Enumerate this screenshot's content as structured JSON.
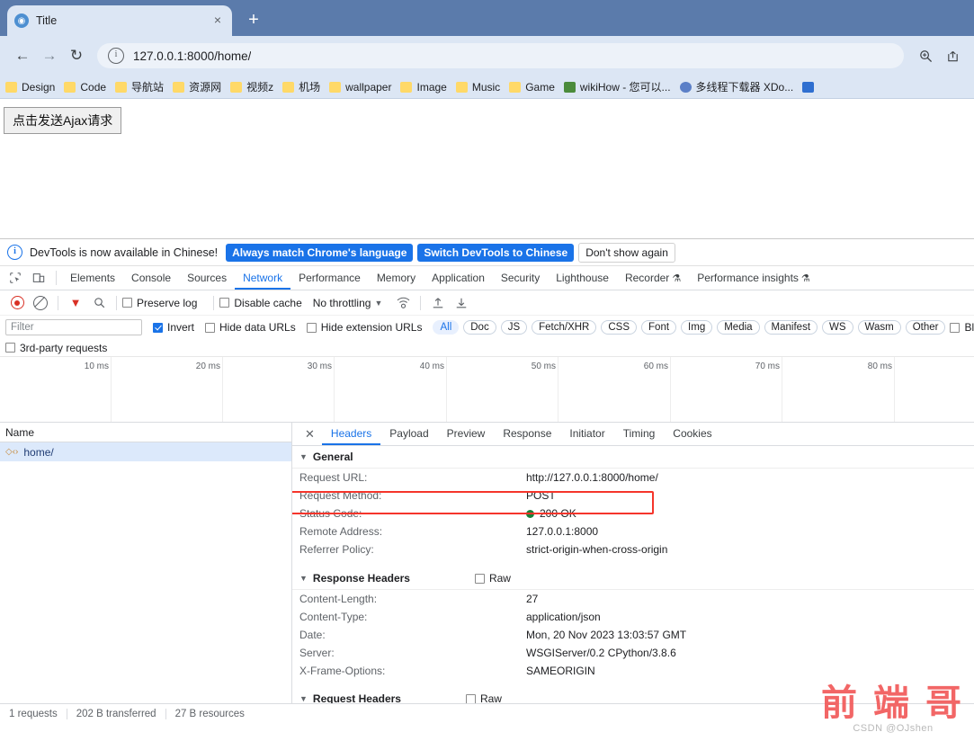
{
  "browser": {
    "tab": {
      "title": "Title",
      "favicon": "globe-icon",
      "close": "×"
    },
    "new_tab": "+",
    "nav": {
      "back": "←",
      "forward": "→",
      "reload": "↻"
    },
    "omnibox": {
      "info_icon": "ⓘ",
      "url": "127.0.0.1:8000/home/"
    },
    "toolbar_icons": {
      "zoom": "⊕",
      "share": "⤴"
    },
    "bookmarks": [
      {
        "label": "Design",
        "icon": "folder-icon"
      },
      {
        "label": "Code",
        "icon": "folder-icon"
      },
      {
        "label": "导航站",
        "icon": "folder-icon"
      },
      {
        "label": "资源网",
        "icon": "folder-icon"
      },
      {
        "label": "视频z",
        "icon": "folder-icon"
      },
      {
        "label": "机场",
        "icon": "folder-icon"
      },
      {
        "label": "wallpaper",
        "icon": "folder-icon"
      },
      {
        "label": "Image",
        "icon": "folder-icon"
      },
      {
        "label": "Music",
        "icon": "folder-icon"
      },
      {
        "label": "Game",
        "icon": "folder-icon"
      },
      {
        "label": "wikiHow - 您可以...",
        "icon": "wikihow-favicon"
      },
      {
        "label": "多线程下载器 XDo...",
        "icon": "xdown-favicon"
      },
      {
        "label": "",
        "icon": "site-favicon"
      }
    ]
  },
  "page": {
    "ajax_button": "点击发送Ajax请求"
  },
  "devtools": {
    "banner": {
      "icon": "info-icon",
      "message": "DevTools is now available in Chinese!",
      "primary_button": "Always match Chrome's language",
      "secondary_button": "Switch DevTools to Chinese",
      "dismiss_button": "Don't show again"
    },
    "panel_tabs": [
      {
        "label": "Elements",
        "active": false
      },
      {
        "label": "Console",
        "active": false
      },
      {
        "label": "Sources",
        "active": false
      },
      {
        "label": "Network",
        "active": true
      },
      {
        "label": "Performance",
        "active": false
      },
      {
        "label": "Memory",
        "active": false
      },
      {
        "label": "Application",
        "active": false
      },
      {
        "label": "Security",
        "active": false
      },
      {
        "label": "Lighthouse",
        "active": false
      },
      {
        "label": "Recorder",
        "active": false,
        "badge": "⚗"
      },
      {
        "label": "Performance insights",
        "active": false,
        "badge": "⚗"
      }
    ],
    "network_toolbar": {
      "record_icon": "record-icon",
      "clear_icon": "clear-icon",
      "filter_icon": "funnel-icon",
      "search_icon": "search-icon",
      "preserve_log": {
        "label": "Preserve log",
        "checked": false
      },
      "disable_cache": {
        "label": "Disable cache",
        "checked": false
      },
      "throttling": "No throttling",
      "throttling_caret": "▼",
      "wifi_icon": "wifi-settings-icon",
      "import_icon": "import-har-icon",
      "export_icon": "export-har-icon"
    },
    "filter_bar": {
      "filter_placeholder": "Filter",
      "filter_value": "",
      "invert": {
        "label": "Invert",
        "checked": true
      },
      "hide_data_urls": {
        "label": "Hide data URLs",
        "checked": false
      },
      "hide_extension_urls": {
        "label": "Hide extension URLs",
        "checked": false
      },
      "types": [
        "All",
        "Doc",
        "JS",
        "Fetch/XHR",
        "CSS",
        "Font",
        "Img",
        "Media",
        "Manifest",
        "WS",
        "Wasm",
        "Other"
      ],
      "selected_type": "All",
      "blocked": {
        "label": "Blocked r",
        "checked": false
      },
      "third_party": {
        "label": "3rd-party requests",
        "checked": false
      }
    },
    "timeline_ticks": [
      "10 ms",
      "20 ms",
      "30 ms",
      "40 ms",
      "50 ms",
      "60 ms",
      "70 ms",
      "80 ms"
    ],
    "requests": {
      "column_header": "Name",
      "rows": [
        {
          "name": "home/",
          "icon": "xhr-icon",
          "selected": true
        }
      ]
    },
    "detail_tabs": [
      {
        "label": "Headers",
        "active": true
      },
      {
        "label": "Payload",
        "active": false
      },
      {
        "label": "Preview",
        "active": false
      },
      {
        "label": "Response",
        "active": false
      },
      {
        "label": "Initiator",
        "active": false
      },
      {
        "label": "Timing",
        "active": false
      },
      {
        "label": "Cookies",
        "active": false
      }
    ],
    "detail_close": "✕",
    "sections": {
      "general": {
        "title": "General",
        "triangle": "▼",
        "rows": [
          {
            "key": "Request URL:",
            "value": "http://127.0.0.1:8000/home/"
          },
          {
            "key": "Request Method:",
            "value": "POST"
          },
          {
            "key": "Status Code:",
            "value": "200 OK",
            "status_dot": "#178038"
          },
          {
            "key": "Remote Address:",
            "value": "127.0.0.1:8000"
          },
          {
            "key": "Referrer Policy:",
            "value": "strict-origin-when-cross-origin"
          }
        ]
      },
      "response_headers": {
        "title": "Response Headers",
        "triangle": "▼",
        "raw_label": "Raw",
        "raw_checked": false,
        "rows": [
          {
            "key": "Content-Length:",
            "value": "27"
          },
          {
            "key": "Content-Type:",
            "value": "application/json",
            "highlighted": true
          },
          {
            "key": "Date:",
            "value": "Mon, 20 Nov 2023 13:03:57 GMT"
          },
          {
            "key": "Server:",
            "value": "WSGIServer/0.2 CPython/3.8.6"
          },
          {
            "key": "X-Frame-Options:",
            "value": "SAMEORIGIN"
          }
        ]
      },
      "request_headers": {
        "title": "Request Headers",
        "triangle": "▼",
        "raw_label": "Raw",
        "raw_checked": false
      }
    },
    "status_bar": {
      "requests": "1 requests",
      "transferred": "202 B transferred",
      "resources": "27 B resources"
    }
  },
  "watermark": {
    "text": "前 端 哥",
    "subtext": "CSDN @OJshen",
    "color": "#f15a5a"
  }
}
